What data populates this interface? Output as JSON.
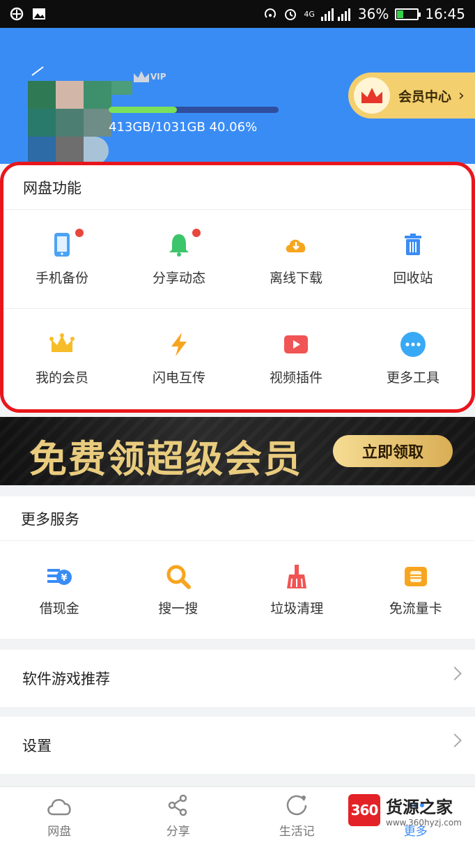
{
  "status_bar": {
    "battery": "36%",
    "time": "16:45",
    "network": "4G"
  },
  "header": {
    "vip_badge": "VIP",
    "storage_text": "413GB/1031GB 40.06%",
    "storage_fraction": 0.4006,
    "vip_center_label": "会员中心"
  },
  "functions": {
    "title": "网盘功能",
    "items": [
      {
        "label": "手机备份",
        "icon": "phone-icon",
        "dot": true
      },
      {
        "label": "分享动态",
        "icon": "bell-icon",
        "dot": true
      },
      {
        "label": "离线下载",
        "icon": "cloud-download-icon",
        "dot": false
      },
      {
        "label": "回收站",
        "icon": "trash-icon",
        "dot": false
      },
      {
        "label": "我的会员",
        "icon": "crown-icon",
        "dot": false
      },
      {
        "label": "闪电互传",
        "icon": "lightning-icon",
        "dot": false
      },
      {
        "label": "视频插件",
        "icon": "video-play-icon",
        "dot": false
      },
      {
        "label": "更多工具",
        "icon": "more-dots-icon",
        "dot": false
      }
    ]
  },
  "banner": {
    "text": "免费领超级会员",
    "button": "立即领取"
  },
  "services": {
    "title": "更多服务",
    "items": [
      {
        "label": "借现金",
        "icon": "cash-icon"
      },
      {
        "label": "搜一搜",
        "icon": "search-icon"
      },
      {
        "label": "垃圾清理",
        "icon": "broom-icon"
      },
      {
        "label": "免流量卡",
        "icon": "sim-card-icon"
      }
    ]
  },
  "list": {
    "recommend": "软件游戏推荐",
    "settings": "设置"
  },
  "bottom_nav": [
    {
      "label": "网盘",
      "icon": "cloud-icon"
    },
    {
      "label": "分享",
      "icon": "share-icon"
    },
    {
      "label": "生活记",
      "icon": "life-icon"
    },
    {
      "label": "更多",
      "icon": "more-icon"
    }
  ],
  "watermark": {
    "logo": "360",
    "name": "货源之家",
    "url": "www.360hyzj.com"
  },
  "colors": {
    "header_blue": "#3a8cf5",
    "highlight_red": "#e8161c",
    "storage_green": "#7be05a",
    "vip_gold": "#f3cf6e"
  }
}
